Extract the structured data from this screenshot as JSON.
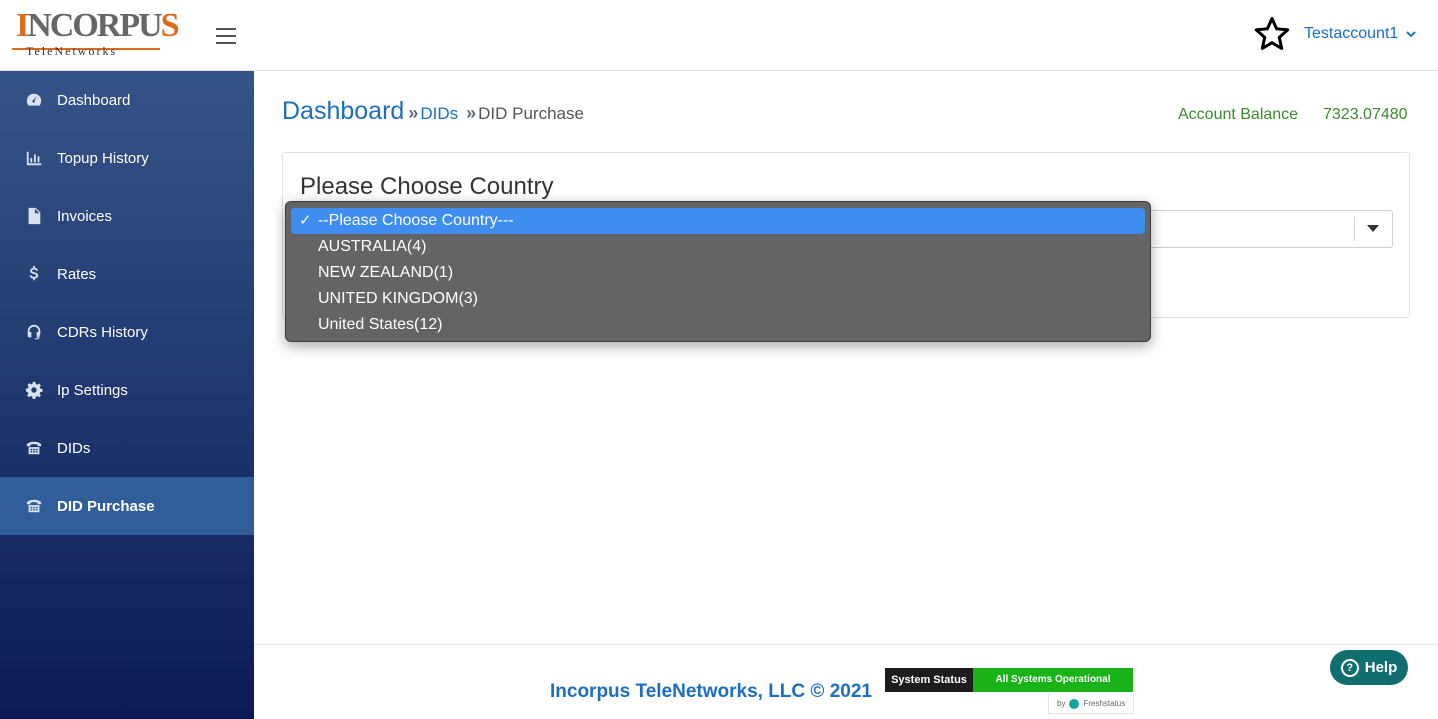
{
  "brand": {
    "logo_main_prefix": "I",
    "logo_main_rest": "NCORPU",
    "logo_main_accent": "S",
    "logo_sub": "TeleNetworks"
  },
  "sidebar": {
    "items": [
      {
        "label": "Dashboard",
        "icon": "tachometer-icon",
        "active": false
      },
      {
        "label": "Topup History",
        "icon": "bar-chart-icon",
        "active": false
      },
      {
        "label": "Invoices",
        "icon": "invoice-icon",
        "active": false
      },
      {
        "label": "Rates",
        "icon": "dollar-icon",
        "active": false
      },
      {
        "label": "CDRs History",
        "icon": "headset-icon",
        "active": false
      },
      {
        "label": "Ip Settings",
        "icon": "gear-icon",
        "active": false
      },
      {
        "label": "DIDs",
        "icon": "phone-icon",
        "active": false
      },
      {
        "label": "DID Purchase",
        "icon": "phone-icon",
        "active": true
      }
    ]
  },
  "topbar": {
    "account_name": "Testaccount1"
  },
  "breadcrumb": {
    "home": "Dashboard",
    "sep": "»",
    "dids": "DIDs",
    "current": "DID Purchase"
  },
  "balance": {
    "label": "Account Balance",
    "value": "7323.07480"
  },
  "card": {
    "title": "Please Choose Country"
  },
  "country_select": {
    "options": [
      {
        "label": "--Please Choose Country---",
        "selected": true
      },
      {
        "label": "AUSTRALIA(4)",
        "selected": false
      },
      {
        "label": "NEW ZEALAND(1)",
        "selected": false
      },
      {
        "label": "UNITED KINGDOM(3)",
        "selected": false
      },
      {
        "label": "United States(12)",
        "selected": false
      }
    ],
    "check_mark": "✓"
  },
  "footer": {
    "copyright": "Incorpus TeleNetworks, LLC © 2021",
    "status_label": "System Status",
    "status_state": "All Systems Operational",
    "status_by": "by",
    "status_provider": "Freshstatus"
  },
  "help": {
    "label": "Help",
    "icon_glyph": "?"
  },
  "colors": {
    "link_blue": "#1b6ec2",
    "balance_green": "#3c8a2e",
    "sidebar_active": "#2f5e9a",
    "dropdown_bg": "#646464",
    "dropdown_selected": "#3d8ef0",
    "status_green": "#19b219",
    "help_teal": "#116e6e"
  }
}
